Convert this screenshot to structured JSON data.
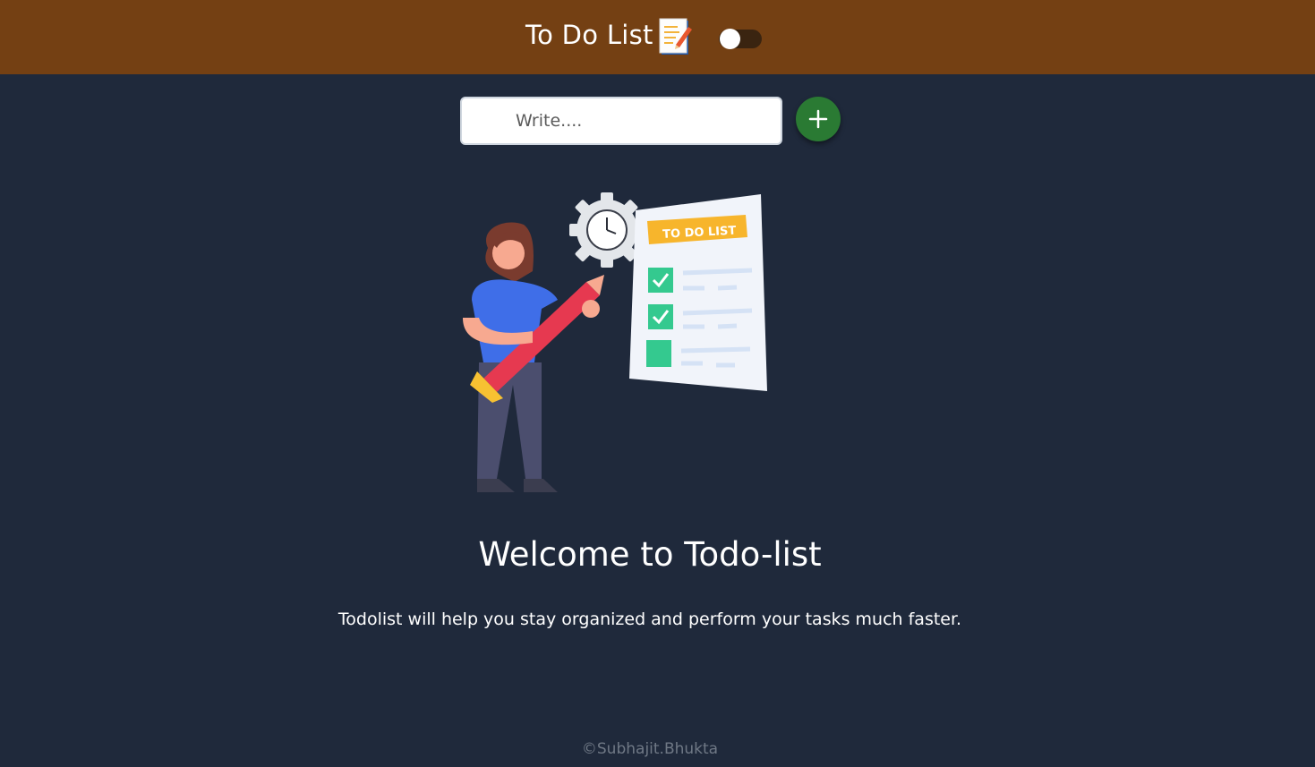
{
  "header": {
    "title": "To Do List",
    "icon": "memo-icon",
    "theme_toggle": {
      "on": false
    }
  },
  "input": {
    "placeholder": "Write....",
    "value": ""
  },
  "add_button": {
    "icon": "plus-icon"
  },
  "illustration": {
    "name": "todo-illustration",
    "banner_text": "TO DO LIST"
  },
  "welcome": {
    "title": "Welcome to Todo-list",
    "subtitle": "Todolist will help you stay organized and perform your tasks much faster."
  },
  "footer": {
    "text": "©Subhajit.Bhukta"
  },
  "colors": {
    "header_bg": "#744013",
    "page_bg": "#1f293b",
    "add_button": "#2a7a33",
    "checkbox": "#34c98f",
    "banner": "#f7b52c"
  }
}
